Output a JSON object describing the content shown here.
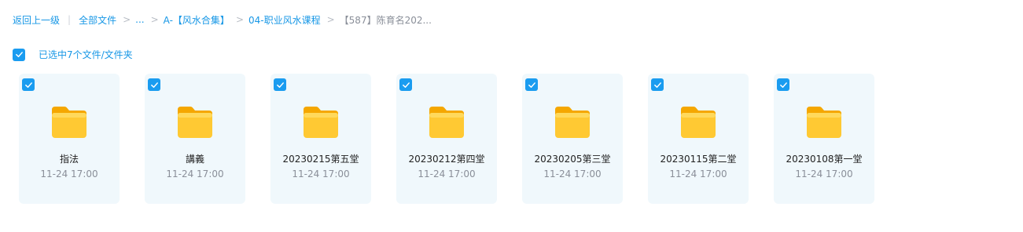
{
  "breadcrumb": {
    "back": "返回上一级",
    "root": "全部文件",
    "ellipsis": "...",
    "level1": "A-【风水合集】",
    "level2": "04-职业风水课程",
    "current": "【587】陈育名202..."
  },
  "selection": {
    "status_text": "已选中7个文件/文件夹",
    "checked": true
  },
  "files": [
    {
      "name": "指法",
      "time": "11-24 17:00"
    },
    {
      "name": "講義",
      "time": "11-24 17:00"
    },
    {
      "name": "20230215第五堂",
      "time": "11-24 17:00"
    },
    {
      "name": "20230212第四堂",
      "time": "11-24 17:00"
    },
    {
      "name": "20230205第三堂",
      "time": "11-24 17:00"
    },
    {
      "name": "20230115第二堂",
      "time": "11-24 17:00"
    },
    {
      "name": "20230108第一堂",
      "time": "11-24 17:00"
    }
  ],
  "colors": {
    "accent": "#1a9cf0",
    "card_bg": "#f0f8fc",
    "folder_yellow": "#ffcb2f"
  }
}
